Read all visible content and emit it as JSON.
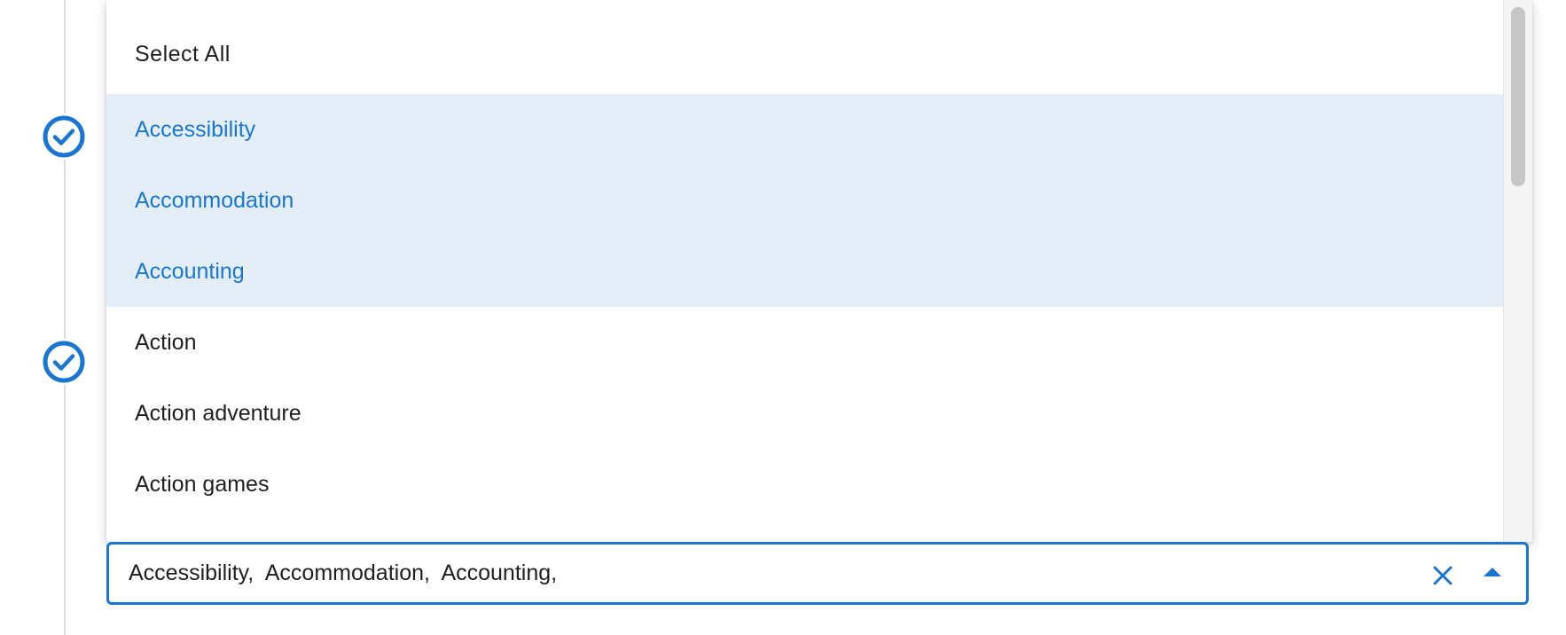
{
  "dropdown": {
    "select_all_label": "Select All",
    "options": [
      {
        "label": "Accessibility",
        "selected": true
      },
      {
        "label": "Accommodation",
        "selected": true
      },
      {
        "label": "Accounting",
        "selected": true
      },
      {
        "label": "Action",
        "selected": false
      },
      {
        "label": "Action adventure",
        "selected": false
      },
      {
        "label": "Action games",
        "selected": false
      }
    ]
  },
  "select_field": {
    "value": "Accessibility,  Accommodation,  Accounting,"
  },
  "stepper": {
    "completed_icon": "check-circle-icon"
  },
  "colors": {
    "accent": "#1976d2",
    "selected_bg": "#e3eef9",
    "text": "#1f1f1f",
    "stepper_line": "#dedede"
  },
  "icons": {
    "clear": "close-icon",
    "toggle": "arrow-up-icon"
  }
}
